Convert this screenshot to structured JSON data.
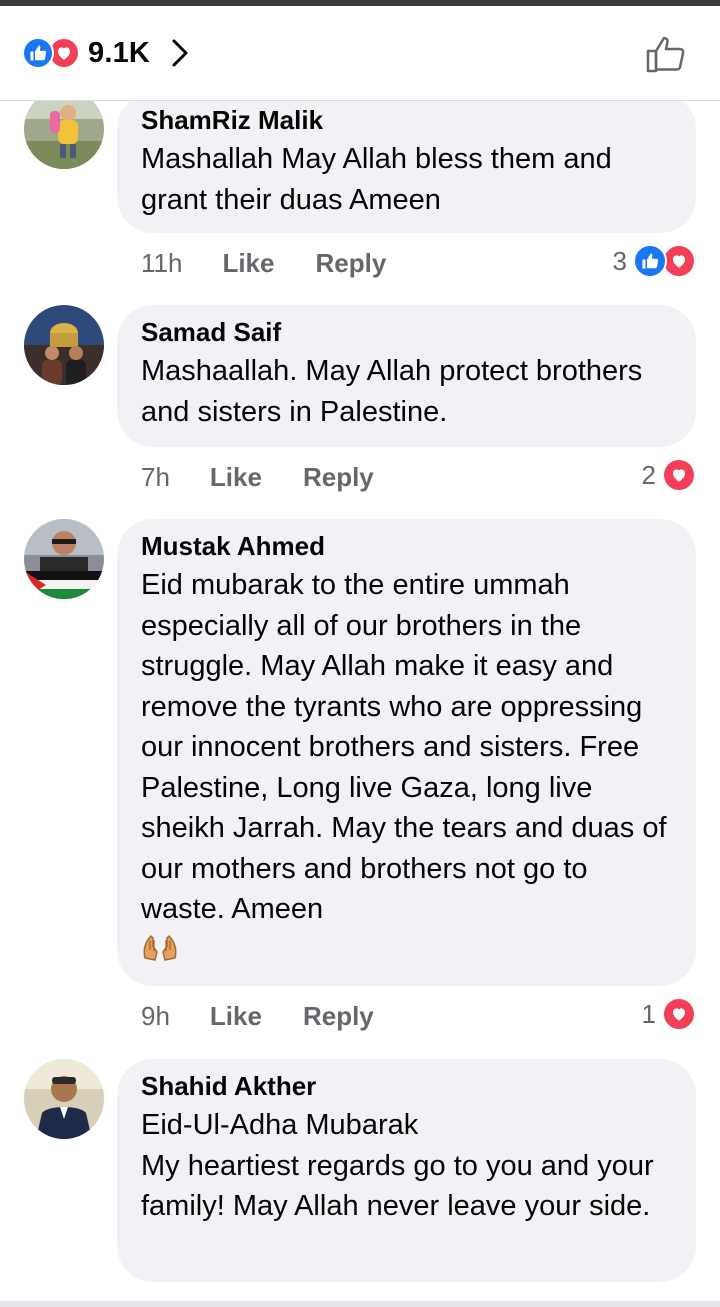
{
  "header": {
    "reaction_count": "9.1K",
    "reaction_icons": [
      "like-icon",
      "love-icon"
    ],
    "colors": {
      "like": "#1877f2",
      "love": "#f33e58"
    }
  },
  "comments": [
    {
      "author": "ShamRiz Malik",
      "text": "Mashallah May Allah bless them and grant their duas Ameen",
      "time": "11h",
      "like_label": "Like",
      "reply_label": "Reply",
      "reaction_count": "3",
      "reactions": [
        "like",
        "love"
      ]
    },
    {
      "author": "Samad Saif",
      "text": "Mashaallah. May Allah protect brothers and sisters in Palestine.",
      "time": "7h",
      "like_label": "Like",
      "reply_label": "Reply",
      "reaction_count": "2",
      "reactions": [
        "love"
      ]
    },
    {
      "author": "Mustak Ahmed",
      "text": "Eid mubarak to the entire ummah especially all of our brothers in the struggle. May Allah make it easy and remove the tyrants who are oppressing our innocent brothers and sisters. Free Palestine, Long live Gaza, long live sheikh Jarrah. May the tears and duas of our mothers and brothers not go to waste. Ameen",
      "emoji": "praying-hands-emoji",
      "time": "9h",
      "like_label": "Like",
      "reply_label": "Reply",
      "reaction_count": "1",
      "reactions": [
        "love"
      ]
    },
    {
      "author": "Shahid Akther",
      "text": "Eid-Ul-Adha Mubarak\nMy heartiest regards go to you and your family! May Allah never leave your side.",
      "time": "",
      "like_label": "",
      "reply_label": "",
      "reaction_count": "",
      "reactions": []
    }
  ]
}
